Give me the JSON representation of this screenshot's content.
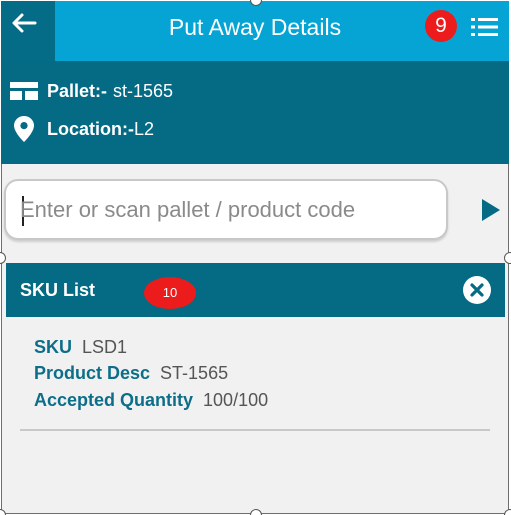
{
  "header": {
    "title": "Put Away Details",
    "notification_badge": "9"
  },
  "info": {
    "pallet_label": "Pallet:-",
    "pallet_value": "st-1565",
    "location_label": "Location:-",
    "location_value": "L2"
  },
  "search": {
    "placeholder": "Enter or scan pallet / product code",
    "value": ""
  },
  "sku_list": {
    "title": "SKU List",
    "badge": "10",
    "items": [
      {
        "sku_label": "SKU",
        "sku_value": "LSD1",
        "desc_label": "Product Desc",
        "desc_value": "ST-1565",
        "qty_label": "Accepted Quantity",
        "qty_value": "100/100"
      }
    ]
  },
  "colors": {
    "appbar": "#05a4d5",
    "dark_teal": "#056a84",
    "badge_red": "#ec1c1c",
    "label_teal": "#0d6e8a"
  },
  "icons": [
    "back-arrow-icon",
    "list-menu-icon",
    "pallet-icon",
    "location-pin-icon",
    "play-arrow-icon",
    "close-circle-icon"
  ]
}
